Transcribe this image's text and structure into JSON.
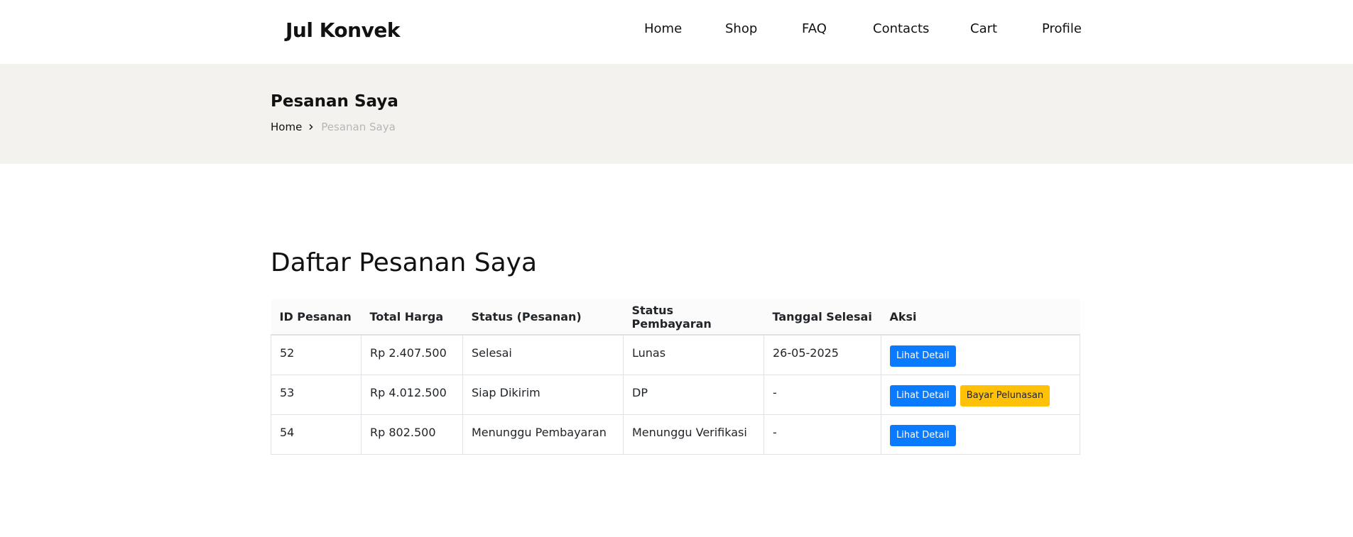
{
  "brand": {
    "name": "Jul Konvek"
  },
  "nav": {
    "items": [
      {
        "label": "Home"
      },
      {
        "label": "Shop"
      },
      {
        "label": "FAQ"
      },
      {
        "label": "Contacts"
      },
      {
        "label": "Cart"
      },
      {
        "label": "Profile"
      }
    ]
  },
  "banner": {
    "title": "Pesanan Saya",
    "breadcrumb": {
      "home": "Home",
      "current": "Pesanan Saya"
    }
  },
  "main": {
    "title": "Daftar Pesanan Saya",
    "table": {
      "headers": [
        "ID Pesanan",
        "Total Harga",
        "Status (Pesanan)",
        "Status Pembayaran",
        "Tanggal Selesai",
        "Aksi"
      ],
      "rows": [
        {
          "id": "52",
          "total": "Rp 2.407.500",
          "order_status": "Selesai",
          "payment_status": "Lunas",
          "finish_date": "26-05-2025",
          "detail_label": "Lihat Detail"
        },
        {
          "id": "53",
          "total": "Rp 4.012.500",
          "order_status": "Siap Dikirim",
          "payment_status": "DP",
          "finish_date": "-",
          "detail_label": "Lihat Detail",
          "pay_label": "Bayar Pelunasan"
        },
        {
          "id": "54",
          "total": "Rp 802.500",
          "order_status": "Menunggu Pembayaran",
          "payment_status": "Menunggu Verifikasi",
          "finish_date": "-",
          "detail_label": "Lihat Detail"
        }
      ]
    }
  },
  "colors": {
    "primary": "#0a7bff",
    "warning": "#ffc107",
    "banner_bg": "#f3f2ee"
  }
}
